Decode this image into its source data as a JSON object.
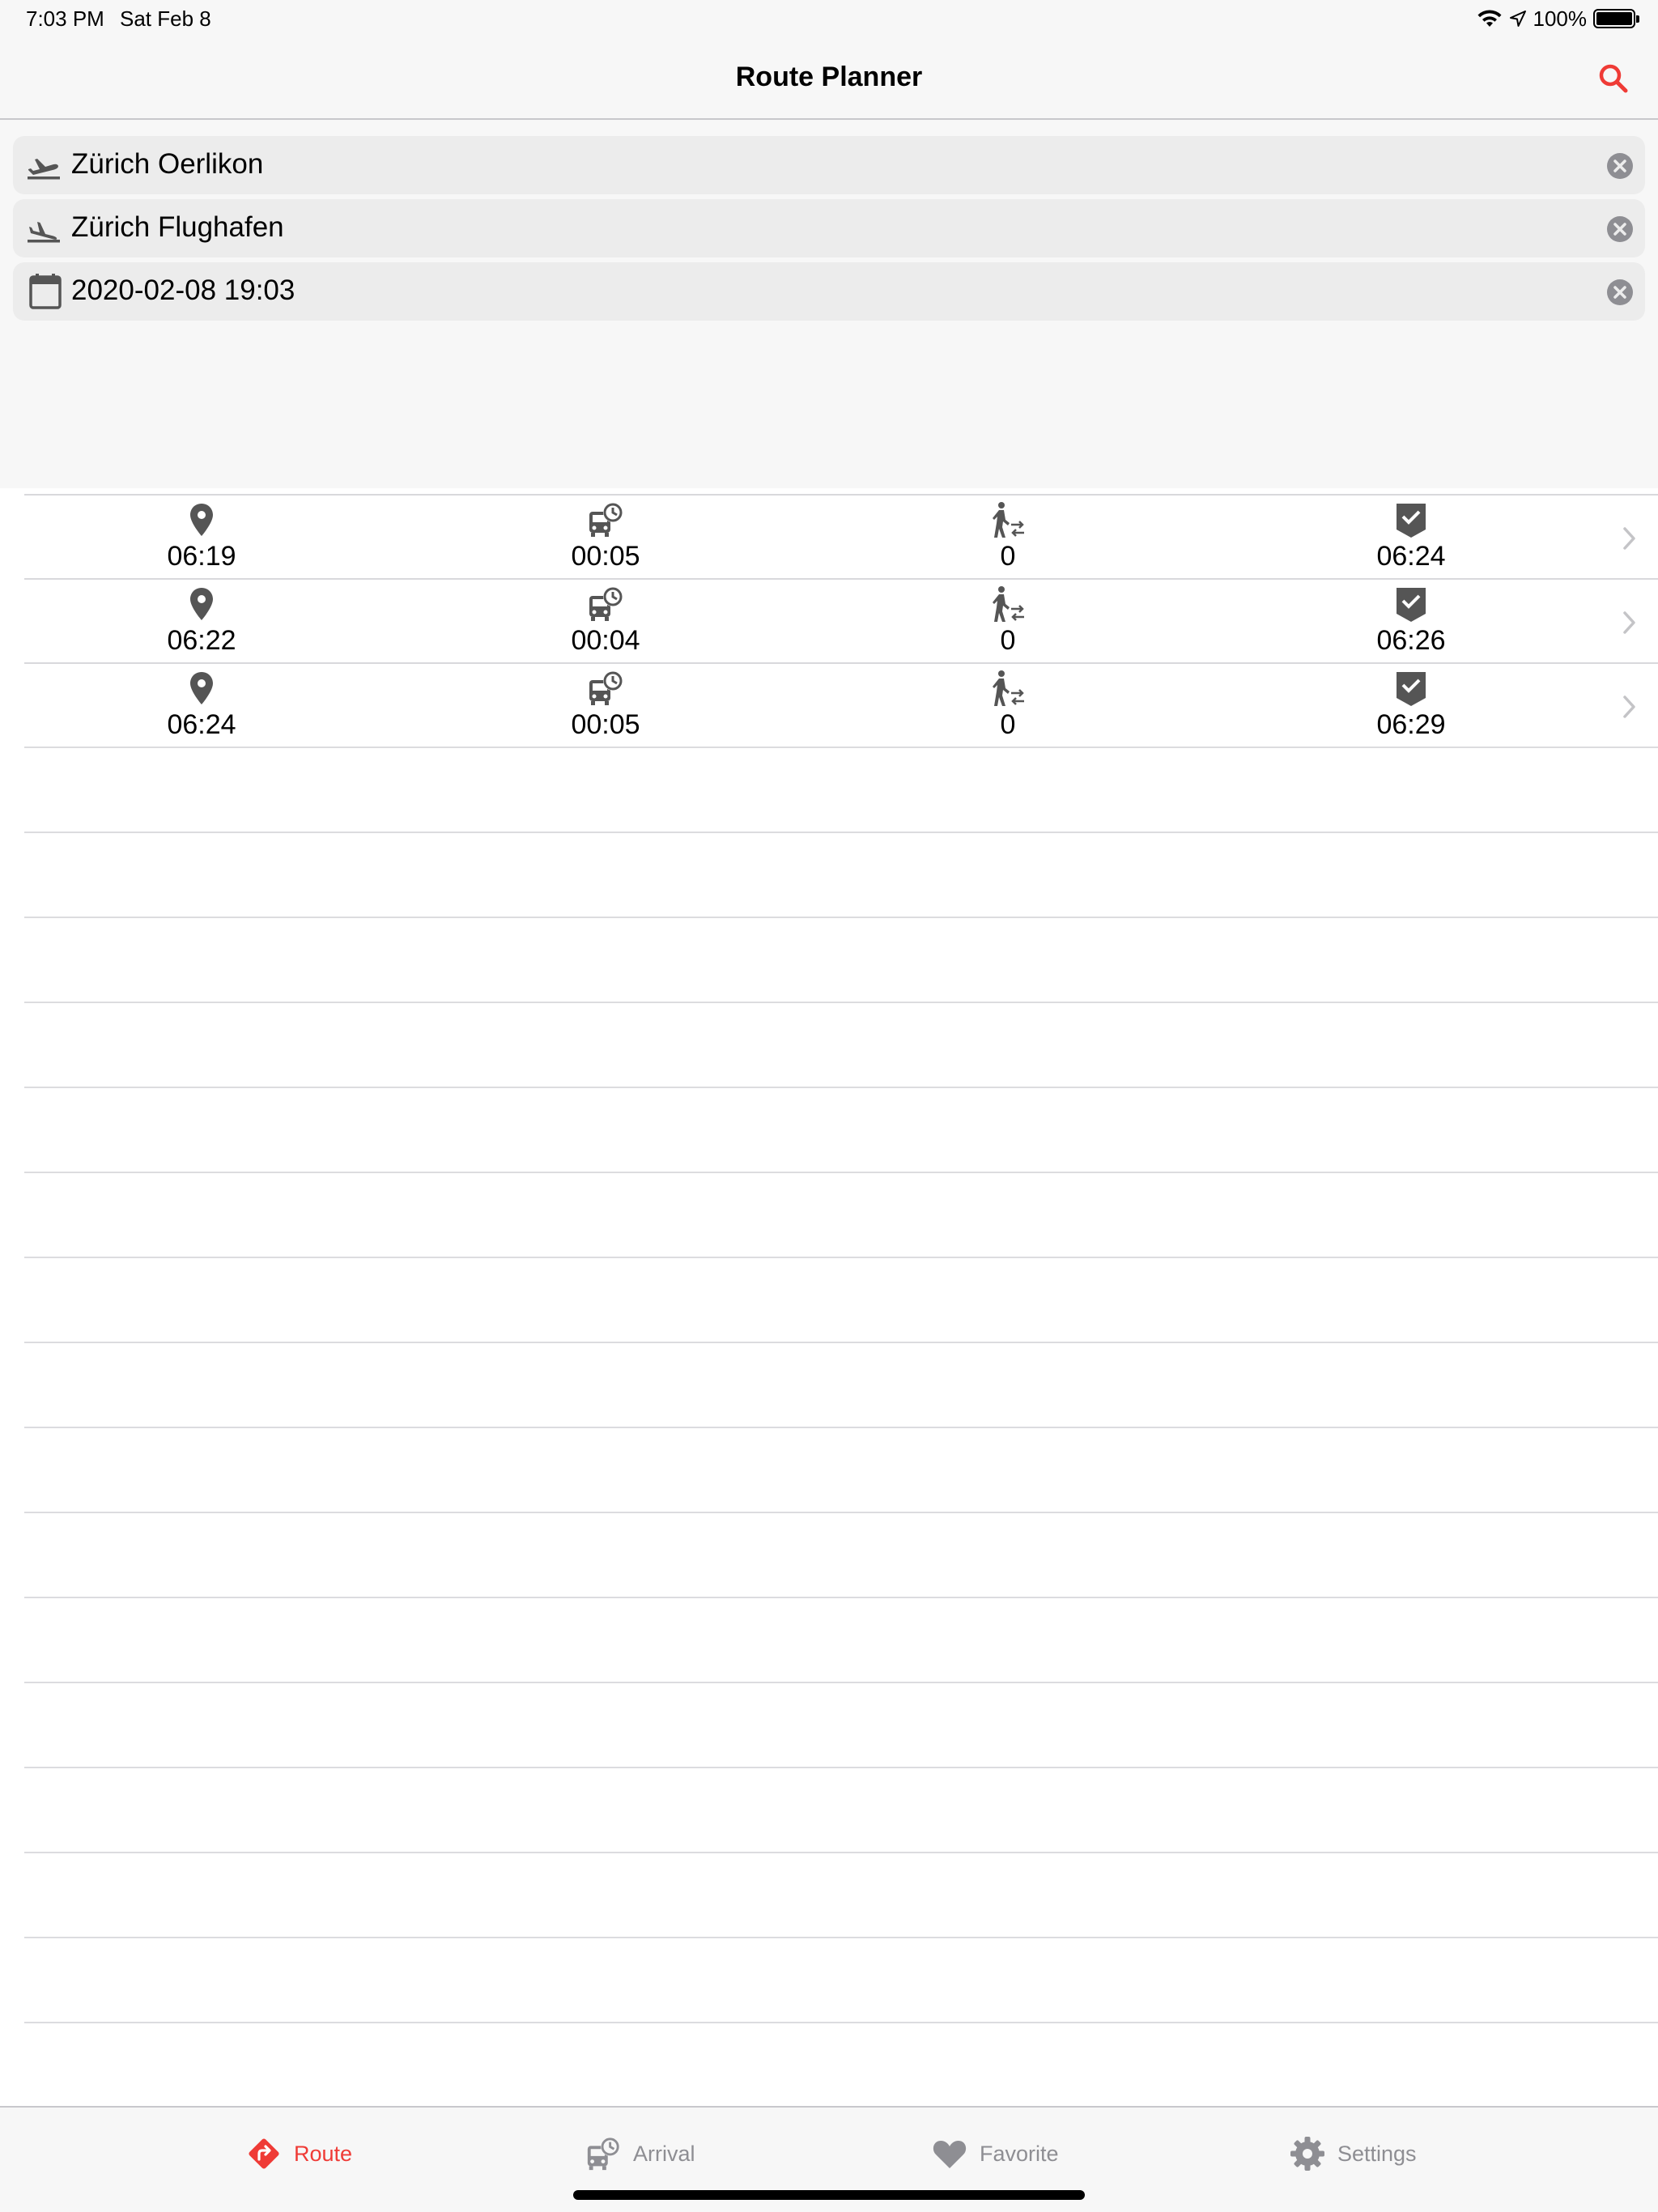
{
  "status": {
    "time": "7:03 PM",
    "date": "Sat Feb 8",
    "battery": "100%"
  },
  "nav": {
    "title": "Route Planner"
  },
  "colors": {
    "accent": "#ef3b36",
    "icon": "#555555",
    "inactive": "#8e8e93"
  },
  "search": {
    "from": {
      "icon": "flight-takeoff-icon",
      "value": "Zürich Oerlikon"
    },
    "to": {
      "icon": "flight-landing-icon",
      "value": "Zürich Flughafen"
    },
    "datetime": {
      "icon": "calendar-icon",
      "value": "2020-02-08 19:03"
    }
  },
  "connections": [
    {
      "departure": "06:19",
      "duration": "00:05",
      "transfers": "0",
      "arrival": "06:24"
    },
    {
      "departure": "06:22",
      "duration": "00:04",
      "transfers": "0",
      "arrival": "06:26"
    },
    {
      "departure": "06:24",
      "duration": "00:05",
      "transfers": "0",
      "arrival": "06:29"
    }
  ],
  "tabs": [
    {
      "label": "Route",
      "icon": "route-icon",
      "active": true
    },
    {
      "label": "Arrival",
      "icon": "bus-clock-icon",
      "active": false
    },
    {
      "label": "Favorite",
      "icon": "heart-icon",
      "active": false
    },
    {
      "label": "Settings",
      "icon": "gear-icon",
      "active": false
    }
  ]
}
